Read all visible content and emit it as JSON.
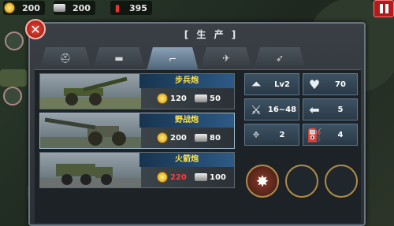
{
  "resources": [
    {
      "icon": "coin-icon",
      "value": "200"
    },
    {
      "icon": "steel-icon",
      "value": "200"
    },
    {
      "icon": "oil-icon",
      "value": "395"
    }
  ],
  "dialog": {
    "title": "[ 生 产 ]",
    "tabs": [
      {
        "icon": "infantry-helmet-icon",
        "glyph": "⛑"
      },
      {
        "icon": "tank-icon",
        "glyph": "▬"
      },
      {
        "icon": "artillery-icon",
        "glyph": "⌐"
      },
      {
        "icon": "aircraft-icon",
        "glyph": "✈"
      },
      {
        "icon": "rocket-icon",
        "glyph": "➶"
      }
    ],
    "active_tab": 2
  },
  "units": [
    {
      "name": "步兵炮",
      "gold": "120",
      "steel": "50",
      "gold_color": "#ffffff"
    },
    {
      "name": "野战炮",
      "gold": "200",
      "steel": "80",
      "gold_color": "#ffffff"
    },
    {
      "name": "火箭炮",
      "gold": "220",
      "steel": "100",
      "gold_color": "#ff3b3b"
    }
  ],
  "selected_unit": 1,
  "stats": {
    "level": "Lv2",
    "hp": "70",
    "attack": "16~48",
    "move": "5",
    "range": "2",
    "fuel": "4"
  },
  "colors": {
    "unit_name": "#ffe14a",
    "accent": "#2d5a85",
    "insufficient": "#ff3b3b"
  }
}
